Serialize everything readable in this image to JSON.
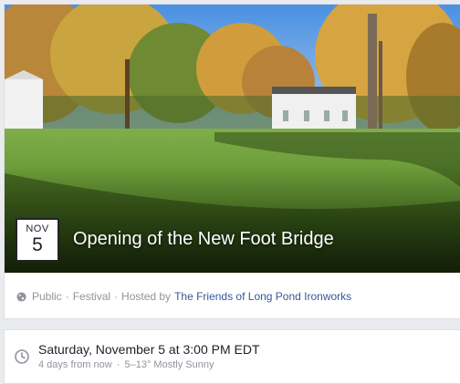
{
  "event": {
    "month": "NOV",
    "day": "5",
    "title": "Opening of the New Foot Bridge",
    "privacy": "Public",
    "category": "Festival",
    "hosted_by_label": "Hosted by",
    "host_name": "The Friends of Long Pond Ironworks",
    "separator": "·"
  },
  "details": {
    "when": "Saturday, November 5 at 3:00 PM EDT",
    "relative": "4 days from now",
    "weather": "5–13° Mostly Sunny"
  },
  "colors": {
    "link": "#365899",
    "meta_gray": "#90949c",
    "background": "#e9ebee"
  },
  "icons": [
    "globe-icon",
    "clock-icon"
  ]
}
